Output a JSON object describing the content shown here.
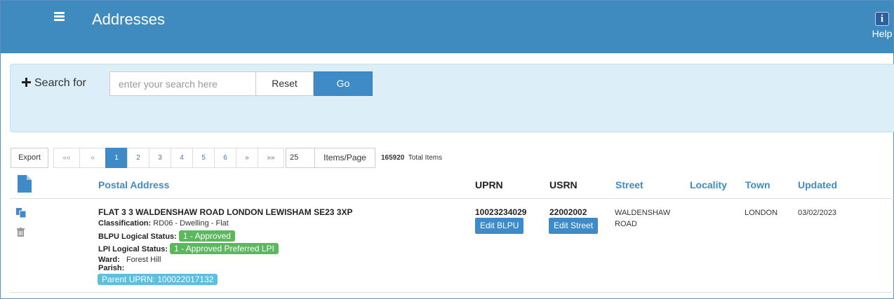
{
  "header": {
    "title": "Addresses",
    "help_label": "Help",
    "help_icon_glyph": "i",
    "background": "#3f8bc0"
  },
  "search": {
    "label": "Search for",
    "placeholder": "enter your search here",
    "reset_label": "Reset",
    "go_label": "Go"
  },
  "toolbar": {
    "export_label": "Export",
    "pager": {
      "first": "««",
      "prev": "«",
      "pages": [
        "1",
        "2",
        "3",
        "4",
        "5",
        "6"
      ],
      "active_page": "1",
      "next": "»",
      "last": "»»"
    },
    "page_size": "25",
    "items_per_page_label": "Items/Page",
    "total_count": "165920",
    "total_label": "Total Items"
  },
  "table": {
    "headers": {
      "postal_address": "Postal Address",
      "uprn": "UPRN",
      "usrn": "USRN",
      "street": "Street",
      "locality": "Locality",
      "town": "Town",
      "updated": "Updated"
    },
    "rows": [
      {
        "address": "FLAT 3 3 WALDENSHAW ROAD LONDON LEWISHAM SE23 3XP",
        "classification_label": "Classification:",
        "classification": "RD06 - Dwelling - Flat",
        "blpu_status_label": "BLPU Logical Status:",
        "blpu_status": "1 - Approved",
        "lpi_status_label": "LPI Logical Status:",
        "lpi_status": "1 - Approved Preferred LPI",
        "ward_label": "Ward:",
        "ward": "Forest Hill",
        "parish_label": "Parish:",
        "parish": "",
        "parent_uprn": "Parent UPRN: 100022017132",
        "uprn": "10023234029",
        "edit_blpu_label": "Edit BLPU",
        "usrn": "22002002",
        "edit_street_label": "Edit Street",
        "street_line1": "WALDENSHAW",
        "street_line2": "ROAD",
        "locality": "",
        "town": "LONDON",
        "updated": "03/02/2023"
      }
    ]
  },
  "colors": {
    "accent": "#3f8bc8",
    "success": "#5cb85c",
    "info": "#5bc0de",
    "search_panel": "#dceef8"
  }
}
